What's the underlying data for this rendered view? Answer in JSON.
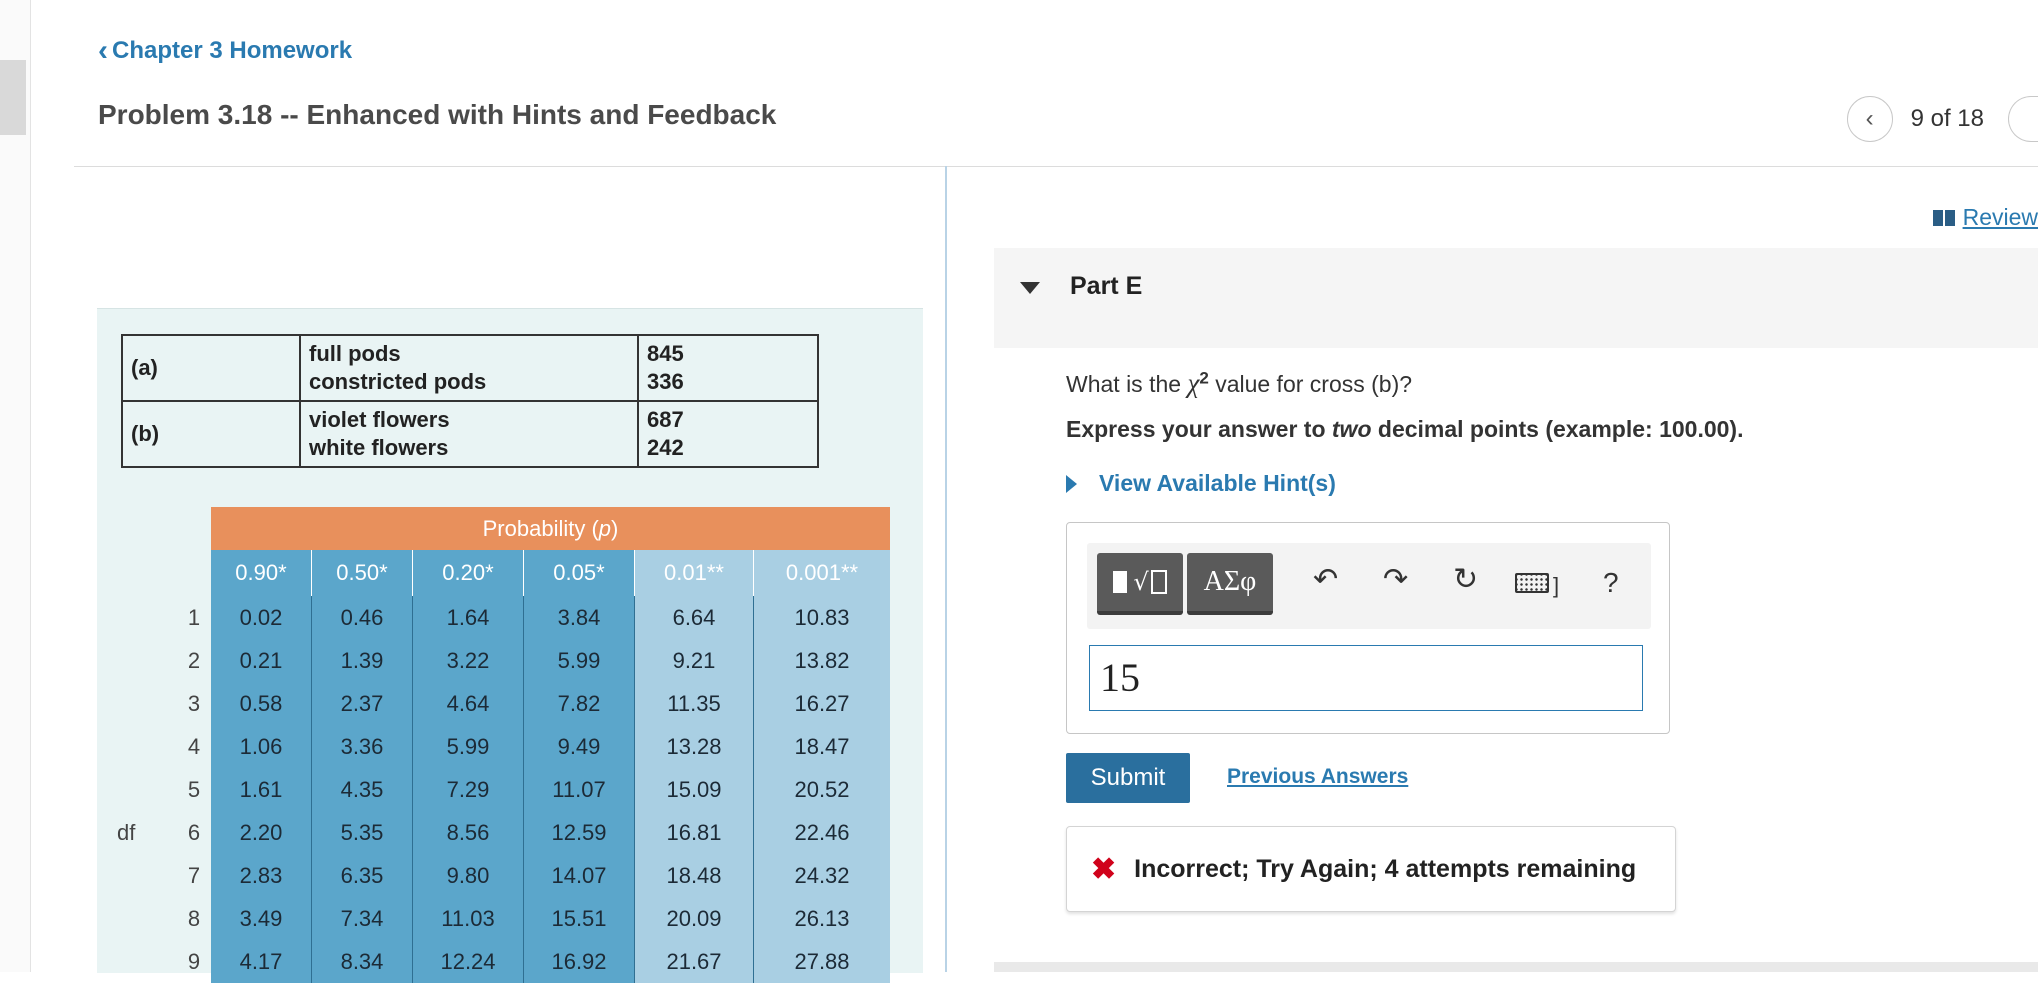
{
  "header": {
    "back_label": "Chapter 3 Homework",
    "problem_title": "Problem 3.18 -- Enhanced with Hints and Feedback",
    "pager_text": "9 of 18",
    "review_label": "Review"
  },
  "part": {
    "title": "Part E",
    "question_prefix": "What is the",
    "question_symbol": "χ",
    "question_superscript": "2",
    "question_suffix": "value for cross (b)?",
    "instruction_prefix": "Express your answer to ",
    "instruction_emphasis": "two",
    "instruction_suffix": " decimal points (example: 100.00).",
    "hint_label": "View Available Hint(s)"
  },
  "toolbar": {
    "symbols_label": "ΑΣφ",
    "undo_icon": "↶",
    "redo_icon": "↷",
    "reset_icon": "↻",
    "keyboard_bracket": "]",
    "help_label": "?"
  },
  "answer": {
    "value": "15"
  },
  "actions": {
    "submit_label": "Submit",
    "previous_answers_label": "Previous Answers"
  },
  "feedback": {
    "icon": "✖",
    "message": "Incorrect; Try Again; 4 attempts remaining"
  },
  "cross_table": {
    "rows": [
      {
        "label": "(a)",
        "item1": "full pods",
        "item2": "constricted pods",
        "val1": "845",
        "val2": "336"
      },
      {
        "label": "(b)",
        "item1": "violet flowers",
        "item2": "white flowers",
        "val1": "687",
        "val2": "242"
      }
    ]
  },
  "chi_table": {
    "prob_header": "Probability (p)",
    "columns": [
      "0.90*",
      "0.50*",
      "0.20*",
      "0.05*",
      "0.01**",
      "0.001**"
    ],
    "df_label": "df",
    "rows": [
      {
        "df": "1",
        "values": [
          "0.02",
          "0.46",
          "1.64",
          "3.84",
          "6.64",
          "10.83"
        ]
      },
      {
        "df": "2",
        "values": [
          "0.21",
          "1.39",
          "3.22",
          "5.99",
          "9.21",
          "13.82"
        ]
      },
      {
        "df": "3",
        "values": [
          "0.58",
          "2.37",
          "4.64",
          "7.82",
          "11.35",
          "16.27"
        ]
      },
      {
        "df": "4",
        "values": [
          "1.06",
          "3.36",
          "5.99",
          "9.49",
          "13.28",
          "18.47"
        ]
      },
      {
        "df": "5",
        "values": [
          "1.61",
          "4.35",
          "7.29",
          "11.07",
          "15.09",
          "20.52"
        ]
      },
      {
        "df": "6",
        "values": [
          "2.20",
          "5.35",
          "8.56",
          "12.59",
          "16.81",
          "22.46"
        ]
      },
      {
        "df": "7",
        "values": [
          "2.83",
          "6.35",
          "9.80",
          "14.07",
          "18.48",
          "24.32"
        ]
      },
      {
        "df": "8",
        "values": [
          "3.49",
          "7.34",
          "11.03",
          "15.51",
          "20.09",
          "26.13"
        ]
      },
      {
        "df": "9",
        "values": [
          "4.17",
          "8.34",
          "12.24",
          "16.92",
          "21.67",
          "27.88"
        ]
      }
    ]
  }
}
